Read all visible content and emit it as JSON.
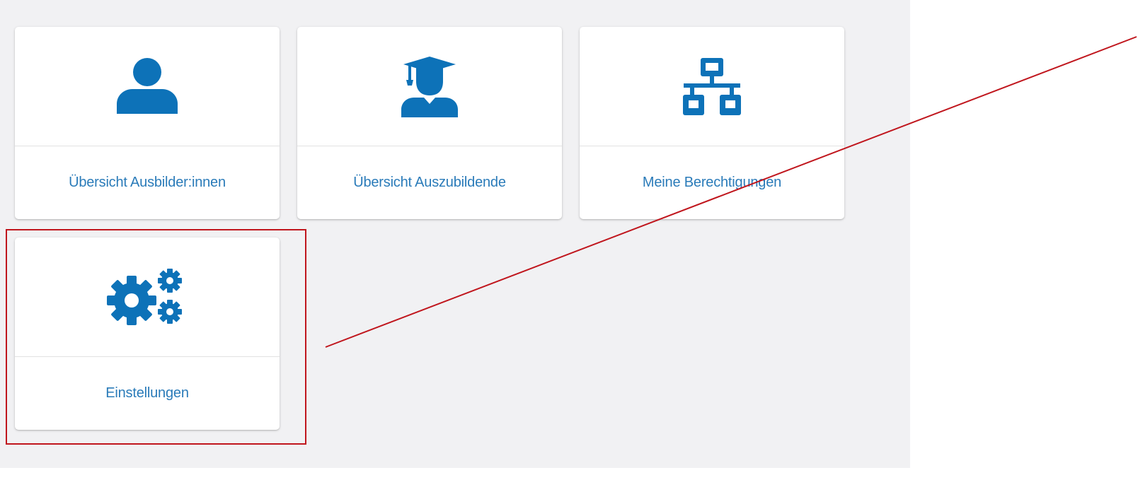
{
  "tiles": [
    {
      "label": "Übersicht Ausbilder:innen",
      "icon": "user-icon"
    },
    {
      "label": "Übersicht Auszubildende",
      "icon": "graduate-icon"
    },
    {
      "label": "Meine Berechtigungen",
      "icon": "sitemap-icon"
    },
    {
      "label": "Einstellungen",
      "icon": "gears-icon"
    }
  ],
  "colors": {
    "icon": "#0d72b8",
    "label": "#2a7bb9",
    "background": "#f1f1f3",
    "annotation": "#c0161d"
  }
}
